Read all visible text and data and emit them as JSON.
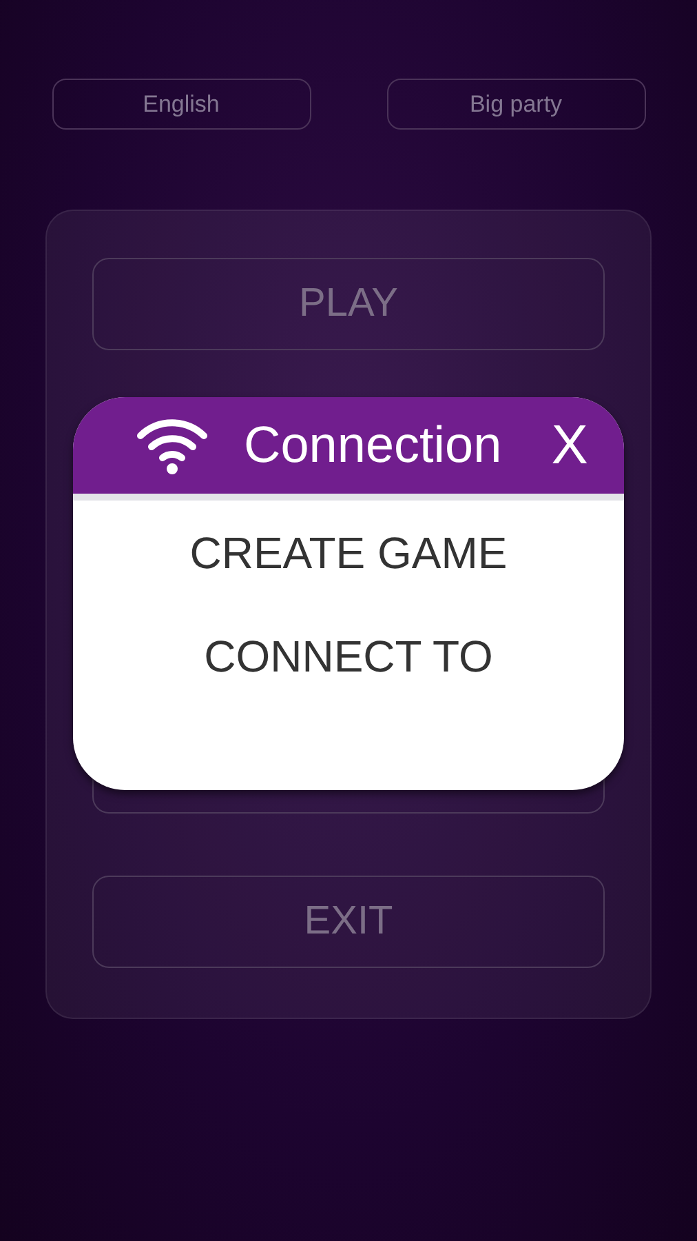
{
  "top_buttons": [
    {
      "label": "English"
    },
    {
      "label": "Big party"
    }
  ],
  "menu": {
    "play": "PLAY",
    "exit": "EXIT"
  },
  "dialog": {
    "title": "Connection",
    "close": "X",
    "options": [
      "CREATE GAME",
      "CONNECT TO"
    ]
  }
}
